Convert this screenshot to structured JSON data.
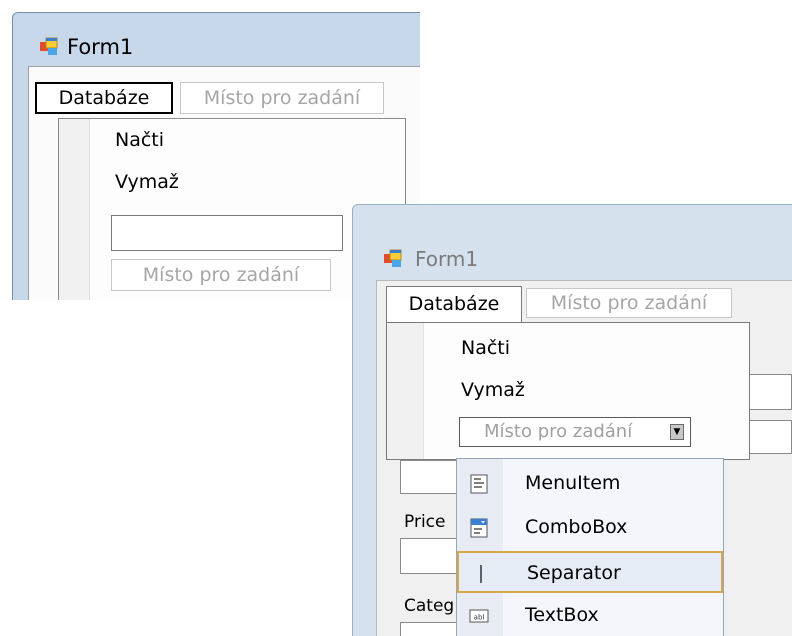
{
  "window1": {
    "title": "Form1",
    "menu_databaze": "Databáze",
    "menu_placeholder": "Místo pro zadání",
    "dropdown_items": [
      "Načti",
      "Vymaž"
    ],
    "dropdown_placeholder": "Místo pro zadání"
  },
  "window2": {
    "title": "Form1",
    "menu_databaze": "Databáze",
    "menu_placeholder": "Místo pro zadání",
    "dropdown_items": [
      "Načti",
      "Vymaž"
    ],
    "combo_add_text": "Místo pro zadání",
    "combo_arrow_icon": "dropdown-arrow-icon",
    "labels": {
      "price": "Price",
      "category": "Categ"
    },
    "type_menu": {
      "items": [
        {
          "label": "MenuItem",
          "icon": "menuitem-icon"
        },
        {
          "label": "ComboBox",
          "icon": "combobox-icon"
        },
        {
          "label": "Separator",
          "icon": "separator-icon",
          "highlighted": true
        },
        {
          "label": "TextBox",
          "icon": "textbox-icon"
        }
      ]
    }
  },
  "colors": {
    "highlight_border": "#d9a74a",
    "window_frame": "#c8d8eb",
    "menu_gutter": "#e6ebf4"
  }
}
